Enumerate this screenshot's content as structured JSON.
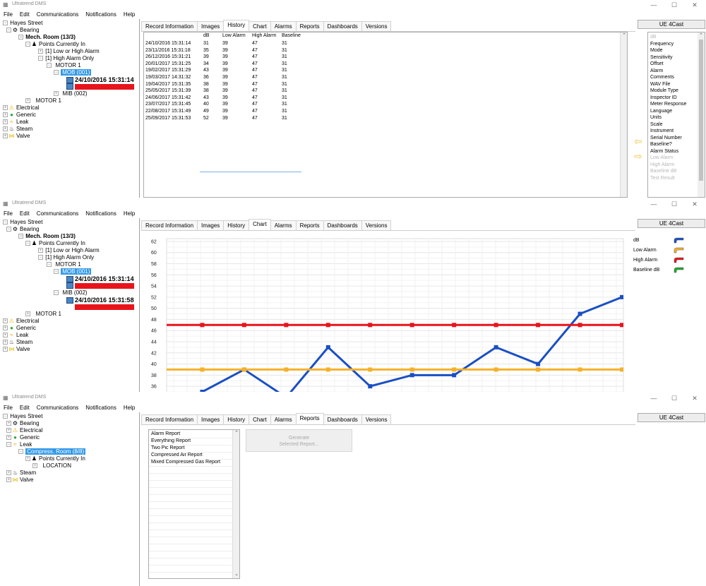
{
  "app": {
    "title": "Ultratrend DMS"
  },
  "window_controls": {
    "minimize": "—",
    "maximize": "☐",
    "close": "✕"
  },
  "menu": [
    "File",
    "Edit",
    "Communications",
    "Notifications",
    "Help"
  ],
  "tabs": [
    "Record Information",
    "Images",
    "History",
    "Chart",
    "Alarms",
    "Reports",
    "Dashboards",
    "Versions"
  ],
  "ue_button": "UE 4Cast",
  "tree_w1": {
    "root": "Hayes Street",
    "bearing": "Bearing",
    "room": "Mech. Room (13/3)",
    "points": "Points Currently In",
    "low_high": "[1] Low or High Alarm",
    "high_only": "[1] High Alarm Only",
    "motor": "MOTOR 1",
    "mob": "MOB (001)",
    "mob_date": "24/10/2016 15:31:14",
    "mib": "MIB (002)",
    "motor2": "MOTOR 1",
    "electrical": "Electrical",
    "generic": "Generic",
    "leak": "Leak",
    "steam": "Steam",
    "valve": "Valve"
  },
  "tree_w2": {
    "root": "Hayes Street",
    "bearing": "Bearing",
    "room": "Mech. Room (13/3)",
    "points": "Points Currently In",
    "low_high": "[1] Low or High Alarm",
    "high_only": "[1] High Alarm Only",
    "motor": "MOTOR 1",
    "mob": "MOB (001)",
    "mob_date": "24/10/2016 15:31:14",
    "mib": "MIB (002)",
    "mib_date": "24/10/2016 15:31:58",
    "motor2": "MOTOR 1",
    "electrical": "Electrical",
    "generic": "Generic",
    "leak": "Leak",
    "steam": "Steam",
    "valve": "Valve"
  },
  "tree_w3": {
    "root": "Hayes Street",
    "bearing": "Bearing",
    "electrical": "Electrical",
    "generic": "Generic",
    "leak": "Leak",
    "room": "Compress. Room (8/8)",
    "points": "Points Currently In",
    "location": "LOCATION",
    "steam": "Steam",
    "valve": "Valve"
  },
  "history": {
    "headers": [
      "dB",
      "Low Alarm",
      "High Alarm",
      "Baseline"
    ],
    "rows": [
      [
        "24/10/2016 15:31:14",
        "31",
        "39",
        "47",
        "31"
      ],
      [
        "23/11/2016 15:31:18",
        "35",
        "39",
        "47",
        "31"
      ],
      [
        "26/12/2016 15:31:21",
        "39",
        "39",
        "47",
        "31"
      ],
      [
        "20/01/2017 15:31:25",
        "34",
        "39",
        "47",
        "31"
      ],
      [
        "19/02/2017 15:31:29",
        "43",
        "39",
        "47",
        "31"
      ],
      [
        "19/03/2017 14:31:32",
        "36",
        "39",
        "47",
        "31"
      ],
      [
        "19/04/2017 15:31:35",
        "38",
        "39",
        "47",
        "31"
      ],
      [
        "25/05/2017 15:31:39",
        "38",
        "39",
        "47",
        "31"
      ],
      [
        "24/06/2017 15:31:42",
        "43",
        "39",
        "47",
        "31"
      ],
      [
        "23/07/2017 15:31:45",
        "40",
        "39",
        "47",
        "31"
      ],
      [
        "22/08/2017 15:31:49",
        "49",
        "39",
        "47",
        "31"
      ],
      [
        "25/09/2017 15:31:53",
        "52",
        "39",
        "47",
        "31"
      ]
    ]
  },
  "fields": {
    "items": [
      {
        "label": "dB",
        "enabled": false
      },
      {
        "label": "Frequency",
        "enabled": true
      },
      {
        "label": "Mode",
        "enabled": true
      },
      {
        "label": "Sensitivity",
        "enabled": true
      },
      {
        "label": "Offset",
        "enabled": true
      },
      {
        "label": "Alarm",
        "enabled": true
      },
      {
        "label": "Comments",
        "enabled": true
      },
      {
        "label": "WAV File",
        "enabled": true
      },
      {
        "label": "Module Type",
        "enabled": true
      },
      {
        "label": "Inspector ID",
        "enabled": true
      },
      {
        "label": "Meter Response",
        "enabled": true
      },
      {
        "label": "Language",
        "enabled": true
      },
      {
        "label": "Units",
        "enabled": true
      },
      {
        "label": "Scale",
        "enabled": true
      },
      {
        "label": "Instrument",
        "enabled": true
      },
      {
        "label": "Serial Number",
        "enabled": true
      },
      {
        "label": "Baseline?",
        "enabled": true
      },
      {
        "label": "Alarm Status",
        "enabled": true
      },
      {
        "label": "Low Alarm",
        "enabled": false
      },
      {
        "label": "High Alarm",
        "enabled": false
      },
      {
        "label": "Baseline dB",
        "enabled": false
      },
      {
        "label": "Test Result",
        "enabled": false
      }
    ]
  },
  "chart_data": {
    "type": "line",
    "ylim": [
      35,
      62
    ],
    "yticks": [
      36,
      38,
      40,
      42,
      44,
      46,
      48,
      50,
      52,
      54,
      56,
      58,
      60,
      62
    ],
    "series": [
      {
        "name": "dB",
        "color": "#1a4fc4",
        "values": [
          31,
          35,
          39,
          34,
          43,
          36,
          38,
          38,
          43,
          40,
          49,
          52
        ]
      },
      {
        "name": "Low Alarm",
        "color": "#f5b12c",
        "values": [
          39,
          39,
          39,
          39,
          39,
          39,
          39,
          39,
          39,
          39,
          39,
          39
        ]
      },
      {
        "name": "High Alarm",
        "color": "#e8141c",
        "values": [
          47,
          47,
          47,
          47,
          47,
          47,
          47,
          47,
          47,
          47,
          47,
          47
        ]
      },
      {
        "name": "Baseline dB",
        "color": "#1ea831",
        "values": []
      }
    ],
    "grid": true,
    "legend": "right"
  },
  "reports": {
    "items": [
      "Alarm Report",
      "Everything Report",
      "Two Pic Report",
      "Compressed Air Report",
      "Mixed Compressed Gas Report"
    ],
    "generate_line1": "Generate",
    "generate_line2": "Selected Report..."
  }
}
